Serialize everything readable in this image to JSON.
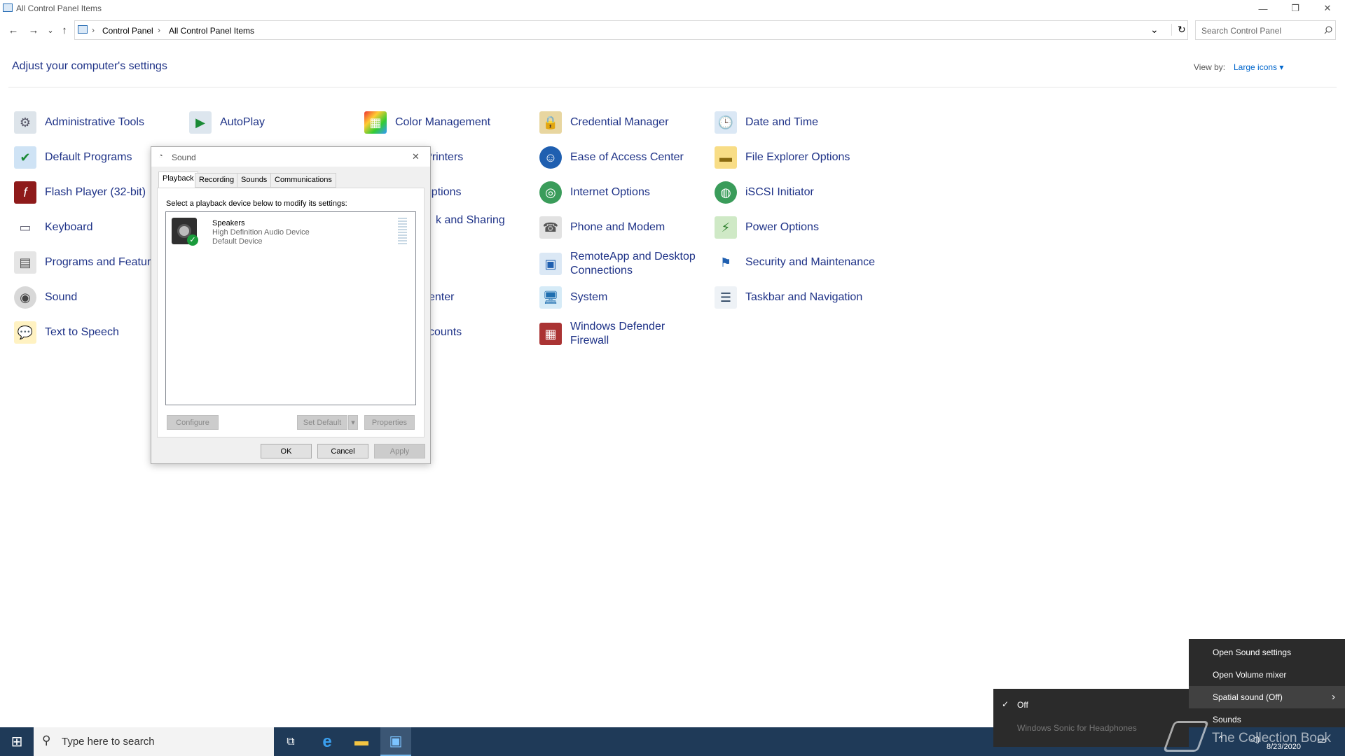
{
  "window": {
    "title": "All Control Panel Items",
    "minimize": "—",
    "restore": "❐",
    "close": "✕"
  },
  "nav": {
    "back": "←",
    "forward": "→",
    "history": "⌄",
    "up": "↑",
    "breadcrumb": [
      "Control Panel",
      "All Control Panel Items"
    ],
    "sep": "›",
    "dropdown": "⌄",
    "refresh": "↻"
  },
  "search": {
    "placeholder": "Search Control Panel"
  },
  "header": {
    "title": "Adjust your computer's settings",
    "view_by_label": "View by:",
    "view_by_value": "Large icons ▾"
  },
  "items": [
    {
      "label": "Administrative Tools",
      "icon": "admin-tools-icon"
    },
    {
      "label": "AutoPlay",
      "icon": "autoplay-icon"
    },
    {
      "label": "Color Management",
      "icon": "color-management-icon"
    },
    {
      "label": "Credential Manager",
      "icon": "credential-manager-icon"
    },
    {
      "label": "Date and Time",
      "icon": "date-time-icon"
    },
    {
      "label": "Default Programs",
      "icon": "default-programs-icon"
    },
    {
      "label": "and Printers",
      "icon": "devices-printers-icon"
    },
    {
      "label": "Ease of Access Center",
      "icon": "ease-of-access-icon"
    },
    {
      "label": "File Explorer Options",
      "icon": "folder-options-icon"
    },
    {
      "label": "Flash Player (32-bit)",
      "icon": "flash-icon"
    },
    {
      "label": "g Options",
      "icon": "indexing-options-icon"
    },
    {
      "label": "Internet Options",
      "icon": "internet-options-icon"
    },
    {
      "label": "iSCSI Initiator",
      "icon": "iscsi-icon"
    },
    {
      "label": "Keyboard",
      "icon": "keyboard-icon"
    },
    {
      "label": "k and Sharing",
      "icon": "network-sharing-icon"
    },
    {
      "label": "Phone and Modem",
      "icon": "phone-modem-icon"
    },
    {
      "label": "Power Options",
      "icon": "power-options-icon"
    },
    {
      "label": "Programs and Feature",
      "icon": "programs-features-icon"
    },
    {
      "label": "RemoteApp and Desktop Connections",
      "icon": "remoteapp-icon"
    },
    {
      "label": "Security and Maintenance",
      "icon": "security-flag-icon"
    },
    {
      "label": "Sound",
      "icon": "sound-icon"
    },
    {
      "label": "enter",
      "icon": "sync-center-icon"
    },
    {
      "label": "System",
      "icon": "system-icon"
    },
    {
      "label": "Taskbar and Navigation",
      "icon": "taskbar-icon"
    },
    {
      "label": "Text to Speech",
      "icon": "speech-icon"
    },
    {
      "label": "counts",
      "icon": "user-accounts-icon"
    },
    {
      "label": "Windows Defender Firewall",
      "icon": "firewall-icon"
    }
  ],
  "dialog": {
    "title": "Sound",
    "close": "✕",
    "tabs": [
      "Playback",
      "Recording",
      "Sounds",
      "Communications"
    ],
    "instruction": "Select a playback device below to modify its settings:",
    "device": {
      "name": "Speakers",
      "driver": "High Definition Audio Device",
      "status": "Default Device"
    },
    "buttons": {
      "configure": "Configure",
      "set_default": "Set Default",
      "set_default_arrow": "▾",
      "properties": "Properties",
      "ok": "OK",
      "cancel": "Cancel",
      "apply": "Apply"
    }
  },
  "context_menu": {
    "items": [
      "Open Sound settings",
      "Open Volume mixer",
      "Spatial sound (Off)",
      "Sounds"
    ],
    "arrow": "›"
  },
  "submenu": {
    "check": "✓",
    "items": [
      "Off",
      "Windows Sonic for Headphones"
    ]
  },
  "taskbar": {
    "start": "⊞",
    "search_placeholder": "Type here to search",
    "search_glyph": "⚲",
    "task_view": "⧉",
    "edge": "e",
    "explorer": "▬",
    "control_panel": "▣",
    "date": "8/23/2020",
    "tray_up": "⌃",
    "tray_speaker": "◁)",
    "tray_chat": "▭"
  },
  "watermark": {
    "text": "The Collection Book"
  },
  "colors": {
    "link": "#1e3287",
    "accent": "#0078d7",
    "taskbar": "#1f3a58",
    "menu": "#2b2b2b"
  }
}
